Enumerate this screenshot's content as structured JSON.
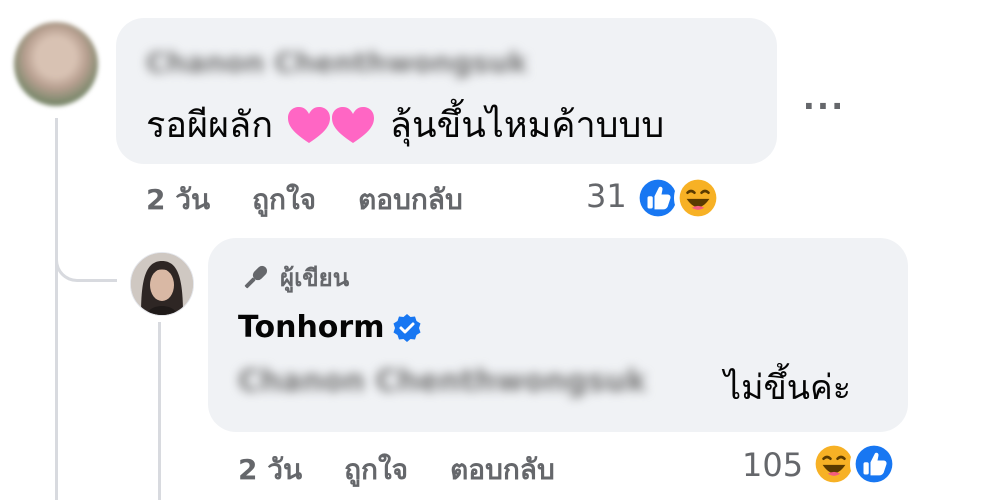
{
  "comment": {
    "author_name": "Chanon Chenthwongsuk",
    "text_before": "รอผีผลัก",
    "text_after": "ลุ้นขึ้นไหมค้าบบบ",
    "emoji": "pink-hearts",
    "more_label": "...",
    "time": "2 วัน",
    "like_label": "ถูกใจ",
    "reply_label": "ตอบกลับ",
    "reaction_count": "31",
    "reactions": [
      "like-icon",
      "haha-icon"
    ]
  },
  "reply": {
    "badge_label": "ผู้เขียน",
    "badge_icon": "microphone-icon",
    "author_name": "Tonhorm",
    "verified_icon": "verified-badge-icon",
    "mention_name": "Chanon Chenthwongsuk",
    "text": "ไม่ขึ้นค่ะ",
    "time": "2 วัน",
    "like_label": "ถูกใจ",
    "reply_label": "ตอบกลับ",
    "reaction_count": "105",
    "reactions": [
      "haha-icon",
      "like-icon"
    ]
  },
  "colors": {
    "bubble": "#f0f2f5",
    "secondary_text": "#65676b",
    "like_blue": "#1877f2",
    "haha_yellow": "#f7b125",
    "heart_pink": "#ff66c4"
  }
}
